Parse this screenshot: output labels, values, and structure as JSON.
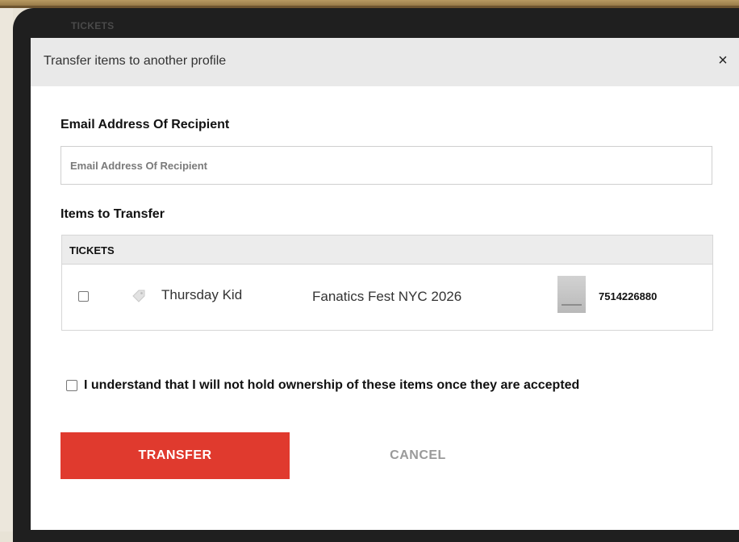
{
  "background": {
    "tickets_label": "TICKETS"
  },
  "modal": {
    "title": "Transfer items to another profile",
    "close_symbol": "×",
    "email": {
      "label": "Email Address Of Recipient",
      "placeholder": "Email Address Of Recipient",
      "value": ""
    },
    "items_label": "Items to Transfer",
    "table": {
      "header": "TICKETS",
      "rows": [
        {
          "checked": false,
          "icon": "tag-icon",
          "name": "Thursday Kid",
          "event": "Fanatics Fest NYC 2026",
          "thumbnail": "ticket-thumbnail",
          "number": "7514226880"
        }
      ]
    },
    "acknowledgement": {
      "checked": false,
      "text": "I understand that I will not hold ownership of these items once they are accepted"
    },
    "buttons": {
      "transfer": "TRANSFER",
      "cancel": "CANCEL"
    }
  },
  "colors": {
    "accent": "#e03a2e",
    "header_bg": "#e9e9e9",
    "frame": "#1f1f1f",
    "cancel_text": "#9a9a9a"
  }
}
